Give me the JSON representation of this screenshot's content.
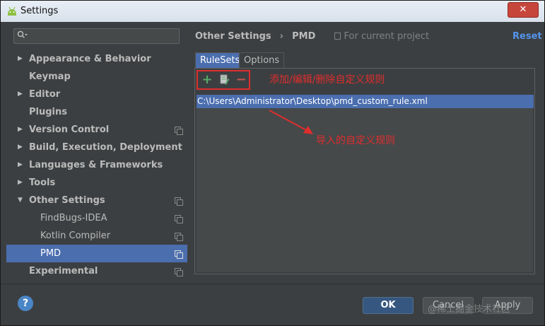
{
  "window": {
    "title": "Settings",
    "close_label": "✕"
  },
  "sidebar": {
    "search_placeholder": "",
    "items": [
      {
        "label": "Appearance & Behavior",
        "arrow": "▶",
        "copy": false
      },
      {
        "label": "Keymap",
        "arrow": "",
        "copy": false
      },
      {
        "label": "Editor",
        "arrow": "▶",
        "copy": false
      },
      {
        "label": "Plugins",
        "arrow": "",
        "copy": false
      },
      {
        "label": "Version Control",
        "arrow": "▶",
        "copy": true
      },
      {
        "label": "Build, Execution, Deployment",
        "arrow": "▶",
        "copy": false
      },
      {
        "label": "Languages & Frameworks",
        "arrow": "▶",
        "copy": false
      },
      {
        "label": "Tools",
        "arrow": "▶",
        "copy": false
      },
      {
        "label": "Other Settings",
        "arrow": "▼",
        "copy": true
      },
      {
        "label": "FindBugs-IDEA",
        "arrow": "",
        "copy": true
      },
      {
        "label": "Kotlin Compiler",
        "arrow": "",
        "copy": true
      },
      {
        "label": "PMD",
        "arrow": "",
        "copy": true
      },
      {
        "label": "Experimental",
        "arrow": "",
        "copy": true
      }
    ]
  },
  "breadcrumb": {
    "parent": "Other Settings",
    "separator": "›",
    "current": "PMD",
    "scope": "For current project"
  },
  "reset_label": "Reset",
  "tabs": [
    {
      "label": "RuleSets"
    },
    {
      "label": "Options"
    }
  ],
  "toolbar": {
    "add": "+",
    "remove": "−"
  },
  "rules": [
    "C:\\Users\\Administrator\\Desktop\\pmd_custom_rule.xml"
  ],
  "annotations": {
    "toolbar_note": "添加/编辑/删除自定义规则",
    "rule_note": "导入的自定义规则"
  },
  "footer": {
    "help": "?",
    "ok": "OK",
    "cancel": "Cancel",
    "apply": "Apply"
  },
  "watermark": "@稀土掘金技术社区",
  "colors": {
    "accent": "#4b6eaf",
    "annotation": "#e02d2d",
    "link": "#5394ec"
  }
}
